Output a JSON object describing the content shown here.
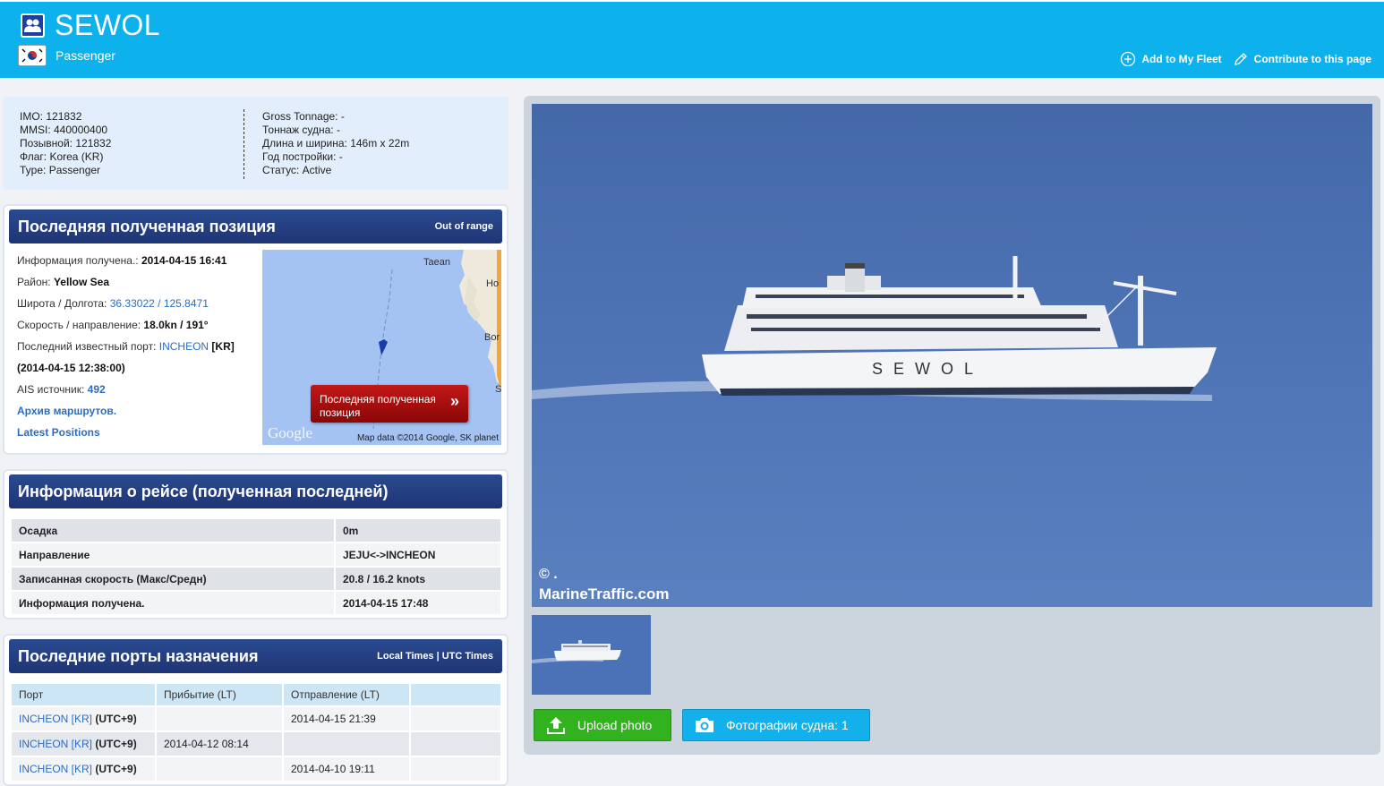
{
  "header": {
    "ship_name": "SEWOL",
    "ship_type": "Passenger",
    "actions": {
      "add_fleet": "Add to My Fleet",
      "contribute": "Contribute to this page"
    }
  },
  "details": {
    "left": [
      {
        "label": "IMO: ",
        "value": "121832"
      },
      {
        "label": "MMSI: ",
        "value": "440000400"
      },
      {
        "label": "Позывной: ",
        "value": "121832"
      },
      {
        "label": "Флаг: ",
        "value": "Korea (KR)"
      },
      {
        "label": "Type: ",
        "value": "Passenger"
      }
    ],
    "right": [
      {
        "label": "Gross Tonnage: ",
        "value": "-"
      },
      {
        "label": "Тоннаж судна: ",
        "value": "-"
      },
      {
        "label": "Длина и ширина: ",
        "value": "146m x 22m"
      },
      {
        "label": "Год постройки: ",
        "value": "-"
      },
      {
        "label": "Статус: ",
        "value": "Active"
      }
    ]
  },
  "position": {
    "title": "Последняя полученная позиция",
    "status": "Out of range",
    "received_label": "Информация получена.: ",
    "received_value": "2014-04-15 16:41",
    "area_label": "Район: ",
    "area_value": "Yellow Sea",
    "latlon_label": "Широта / Долгота: ",
    "lat": "36.33022",
    "lon_sep": " / ",
    "lon": "125.8471",
    "speed_label": "Скорость / направление: ",
    "speed_value": "18.0kn / 191°",
    "port_label": "Последний известный порт: ",
    "port_value": "INCHEON",
    "port_country": " [KR]",
    "port_time": "(2014-04-15 12:38:00)",
    "ais_label": "AIS источник: ",
    "ais_value": "492",
    "archive_link": "Архив маршрутов.",
    "latest_link": "Latest Positions",
    "map": {
      "button": "Последняя полученная позиция",
      "credit": "Map data ©2014 Google, SK planet",
      "google": "Google",
      "labels": [
        "Taean",
        "Ho",
        "Bor",
        "S"
      ]
    }
  },
  "voyage": {
    "title": "Информация о рейсе (полученная последней)",
    "rows": [
      {
        "k": "Осадка",
        "v": "0m"
      },
      {
        "k": "Направление",
        "v": "JEJU<->INCHEON"
      },
      {
        "k": "Записанная скорость (Макс/Средн)",
        "v": "20.8 / 16.2 knots"
      },
      {
        "k": "Информация получена.",
        "v": "2014-04-15 17:48"
      }
    ]
  },
  "ports": {
    "title": "Последние порты назначения",
    "times": "Local Times | UTC Times",
    "columns": [
      "Порт",
      "Прибытие (LT)",
      "Отправление (LT)",
      ""
    ],
    "rows": [
      {
        "port": "INCHEON [KR]",
        "utc": " (UTC+9)",
        "arrival": "",
        "departure": "2014-04-15 21:39"
      },
      {
        "port": "INCHEON [KR]",
        "utc": " (UTC+9)",
        "arrival": "2014-04-12 08:14",
        "departure": ""
      },
      {
        "port": "INCHEON [KR]",
        "utc": " (UTC+9)",
        "arrival": "",
        "departure": "2014-04-10 19:11"
      }
    ]
  },
  "photo": {
    "watermark_copy": "© .",
    "watermark_site": "MarineTraffic.com",
    "hull_text": "SEWOL",
    "upload_button": "Upload photo",
    "photos_button": "Фотографии судна: 1"
  },
  "colors": {
    "header_bg": "#0db1ec",
    "panel_header": "#1e3575",
    "link": "#2d6cc0",
    "upload": "#33b21f",
    "photos": "#12b1ec"
  }
}
